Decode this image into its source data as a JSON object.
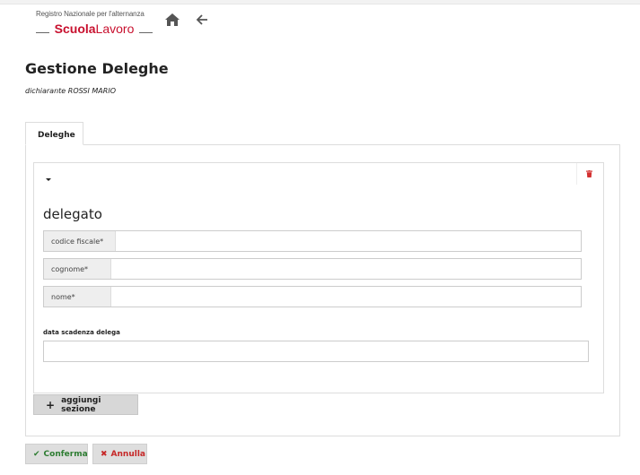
{
  "header": {
    "logo_subtitle": "Registro Nazionale per l'alternanza",
    "logo_bold": "Scuola",
    "logo_light": "Lavoro"
  },
  "page": {
    "title": "Gestione Deleghe",
    "declarant_label": "dichiarante",
    "declarant_name": "ROSSI MARIO"
  },
  "tabs": [
    {
      "label": "Deleghe",
      "active": true
    }
  ],
  "section": {
    "title": "delegato",
    "fields": [
      {
        "label": "codice fiscale*",
        "value": ""
      },
      {
        "label": "cognome*",
        "value": ""
      },
      {
        "label": "nome*",
        "value": ""
      }
    ],
    "date_label": "data scadenza delega",
    "date_value": ""
  },
  "actions": {
    "add_section": "aggiungi sezione",
    "confirm": "Conferma",
    "cancel": "Annulla"
  },
  "colors": {
    "brand_red": "#c8102e",
    "confirm_green": "#2e7d32",
    "cancel_red": "#c62828"
  }
}
